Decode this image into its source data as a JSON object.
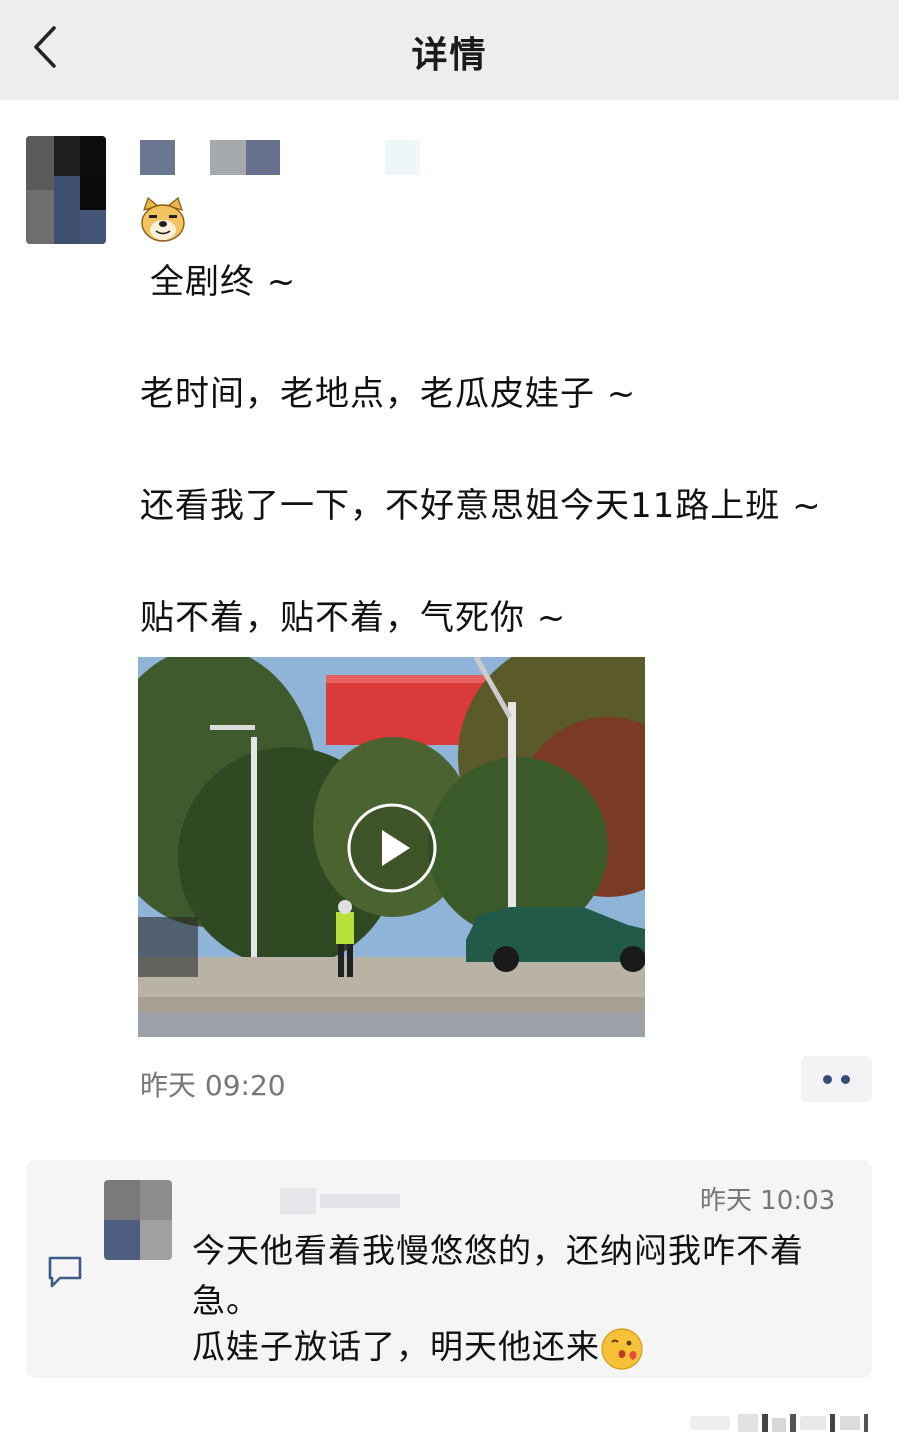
{
  "header": {
    "title": "详情"
  },
  "post": {
    "lines": [
      "全剧终 ~",
      "老时间，老地点，老瓜皮娃子 ~",
      "还看我了一下，不好意思姐今天11路上班 ~",
      "贴不着，贴不着，气死你 ~"
    ],
    "timestamp": "昨天 09:20"
  },
  "comment": {
    "time": "昨天 10:03",
    "lines": [
      "今天他看着我慢悠悠的，还纳闷我咋不着",
      "急。",
      "瓜娃子放话了，明天他还来"
    ]
  },
  "icons": [
    "back-icon",
    "doge-emoji-icon",
    "play-icon",
    "more-dots-icon",
    "comment-icon",
    "kiss-emoji-icon"
  ],
  "colors": {
    "header_bg": "#ededed",
    "comment_bg": "#f5f5f5",
    "more_dots": "#3a4a78",
    "meta_text": "#777777"
  }
}
